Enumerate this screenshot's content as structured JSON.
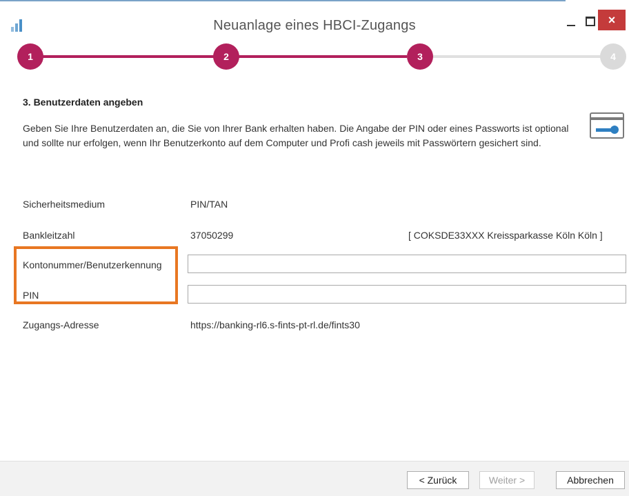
{
  "window": {
    "title": "Neuanlage eines HBCI-Zugangs",
    "close_label": "×"
  },
  "stepper": {
    "steps": [
      "1",
      "2",
      "3",
      "4"
    ],
    "current": 3,
    "active_color": "#b2205c"
  },
  "section": {
    "title": "3. Benutzerdaten angeben",
    "description": "Geben Sie Ihre Benutzerdaten an, die Sie von Ihrer Bank erhalten haben. Die Angabe der PIN oder eines Passworts ist optional und sollte nur erfolgen, wenn Ihr Benutzerkonto auf dem Computer und Profi cash jeweils mit Passwörtern gesichert sind.",
    "icon": "bank-card-key-icon"
  },
  "fields": {
    "security_medium": {
      "label": "Sicherheitsmedium",
      "value": "PIN/TAN"
    },
    "bank_code": {
      "label": "Bankleitzahl",
      "value": "37050299",
      "bank_info": "[ COKSDE33XXX Kreissparkasse Köln Köln ]"
    },
    "account_number": {
      "label": "Kontonummer/Benutzerkennung",
      "value": ""
    },
    "pin": {
      "label": "PIN",
      "value": ""
    },
    "access_address": {
      "label": "Zugangs-Adresse",
      "value": "https://banking-rl6.s-fints-pt-rl.de/fints30"
    }
  },
  "highlight_color": "#e87722",
  "footer": {
    "back_label": "< Zurück",
    "next_label": "Weiter >",
    "cancel_label": "Abbrechen"
  }
}
